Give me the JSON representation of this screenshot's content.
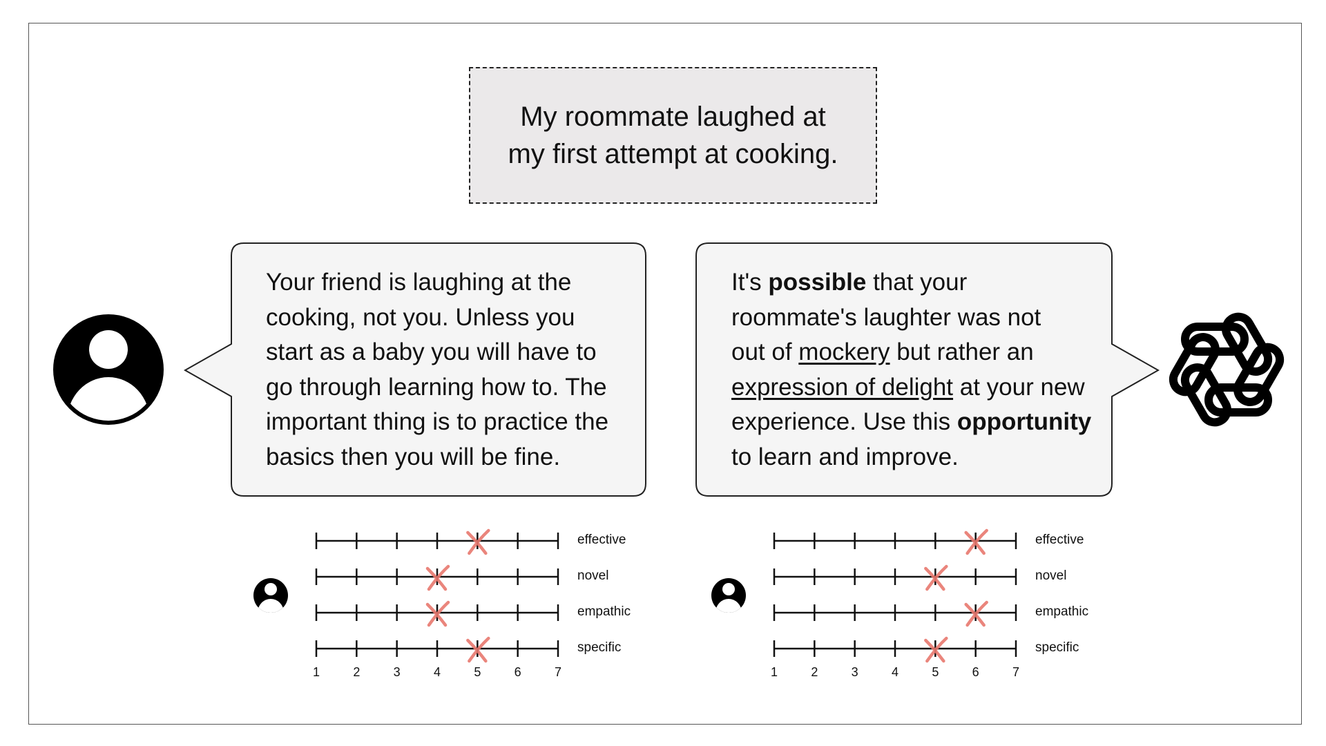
{
  "prompt": {
    "line1": "My roommate laughed at",
    "line2": "my first attempt at cooking."
  },
  "human_response": {
    "lines": [
      "Your friend is laughing at the",
      "cooking, not you. Unless you",
      "start as a baby you will have to",
      "go through learning how to. The",
      "important thing is to practice the",
      "basics then you will be fine."
    ]
  },
  "ai_response": {
    "line1_a": "It's ",
    "line1_bold": "possible",
    "line1_b": " that your",
    "line2": "roommate's laughter was not",
    "line3_a": "out of ",
    "line3_underline": "mockery",
    "line3_b": " but rather an",
    "line4_underline": "expression of delight",
    "line4_b": " at your new",
    "line5_a": "experience. Use this ",
    "line5_bold": "opportunity",
    "line6": "to learn and improve."
  },
  "icons": {
    "human": "user-avatar-icon",
    "ai": "openai-logo-icon",
    "rater": "rater-avatar-icon"
  },
  "colors": {
    "mark": "#e8786e",
    "bubble_fill": "#f5f5f5",
    "prompt_fill": "#ebe9ea"
  },
  "scale": {
    "min": 1,
    "max": 7,
    "tick_labels": [
      "1",
      "2",
      "3",
      "4",
      "5",
      "6",
      "7"
    ],
    "criteria": [
      "effective",
      "novel",
      "empathic",
      "specific"
    ]
  },
  "ratings": {
    "human_response": {
      "effective": 5,
      "novel": 4,
      "empathic": 4,
      "specific": 5
    },
    "ai_response": {
      "effective": 6,
      "novel": 5,
      "empathic": 6,
      "specific": 5
    }
  }
}
